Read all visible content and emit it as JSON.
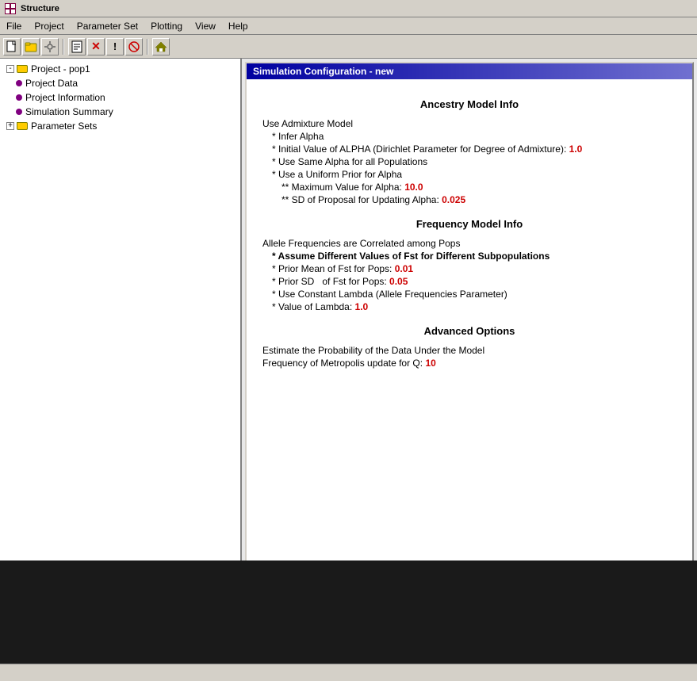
{
  "app": {
    "title": "Structure",
    "title_icon": "grid-icon"
  },
  "menu": {
    "items": [
      "File",
      "Project",
      "Parameter Set",
      "Plotting",
      "View",
      "Help"
    ]
  },
  "toolbar": {
    "buttons": [
      {
        "name": "new-button",
        "label": "📄"
      },
      {
        "name": "open-button",
        "label": "📁"
      },
      {
        "name": "settings-button",
        "label": "⚙"
      },
      {
        "name": "sep1",
        "type": "separator"
      },
      {
        "name": "doc-button",
        "label": "📃"
      },
      {
        "name": "delete-button",
        "label": "✕"
      },
      {
        "name": "info-button",
        "label": "ℹ"
      },
      {
        "name": "stop-button",
        "label": "⊗"
      },
      {
        "name": "sep2",
        "type": "separator"
      },
      {
        "name": "home-button",
        "label": "🏠"
      }
    ]
  },
  "tree": {
    "root": {
      "label": "Project - pop1",
      "children": [
        {
          "label": "Project Data",
          "type": "leaf"
        },
        {
          "label": "Project Information",
          "type": "leaf"
        },
        {
          "label": "Simulation Summary",
          "type": "leaf"
        },
        {
          "label": "Parameter Sets",
          "type": "folder",
          "expanded": false
        }
      ]
    }
  },
  "config_window": {
    "title": "Simulation Configuration - new",
    "sections": [
      {
        "id": "ancestry",
        "header": "Ancestry Model Info",
        "lines": [
          {
            "text": "Use Admixture Model",
            "indent": 0,
            "bold": false
          },
          {
            "text": "* Infer Alpha",
            "indent": 0,
            "bold": false
          },
          {
            "text": "* Initial Value of ALPHA (Dirichlet Parameter for Degree of Admixture):  1.0",
            "indent": 0,
            "bold": false,
            "has_value": true,
            "value": "1.0",
            "value_pos": "end"
          },
          {
            "text": "* Use Same Alpha for all Populations",
            "indent": 0,
            "bold": false
          },
          {
            "text": "* Use a Uniform Prior for Alpha",
            "indent": 0,
            "bold": false
          },
          {
            "text": "** Maximum Value for Alpha: 10.0",
            "indent": 1,
            "bold": false,
            "has_value": true,
            "value": "10.0"
          },
          {
            "text": "** SD of Proposal for Updating Alpha: 0.025",
            "indent": 1,
            "bold": false,
            "has_value": true,
            "value": "0.025"
          }
        ]
      },
      {
        "id": "frequency",
        "header": "Frequency Model Info",
        "lines": [
          {
            "text": "Allele Frequencies are Correlated among Pops",
            "indent": 0,
            "bold": false
          },
          {
            "text": "* Assume Different Values of Fst for Different Subpopulations",
            "indent": 0,
            "bold": true
          },
          {
            "text": "* Prior Mean of Fst for Pops: 0.01",
            "indent": 0,
            "bold": false,
            "has_value": true,
            "value": "0.01"
          },
          {
            "text": "* Prior SD   of Fst for Pops: 0.05",
            "indent": 0,
            "bold": false,
            "has_value": true,
            "value": "0.05"
          },
          {
            "text": "* Use Constant Lambda (Allele Frequencies Parameter)",
            "indent": 0,
            "bold": false
          },
          {
            "text": "* Value of Lambda: 1.0",
            "indent": 0,
            "bold": false,
            "has_value": true,
            "value": "1.0"
          }
        ]
      },
      {
        "id": "advanced",
        "header": "Advanced Options",
        "lines": [
          {
            "text": "Estimate the Probability of the Data Under the Model",
            "indent": 0,
            "bold": false
          },
          {
            "text": "Frequency of Metropolis update for Q: 10",
            "indent": 0,
            "bold": false,
            "has_value": true,
            "value": "10"
          }
        ]
      }
    ]
  },
  "status_bar": {
    "text": ""
  }
}
